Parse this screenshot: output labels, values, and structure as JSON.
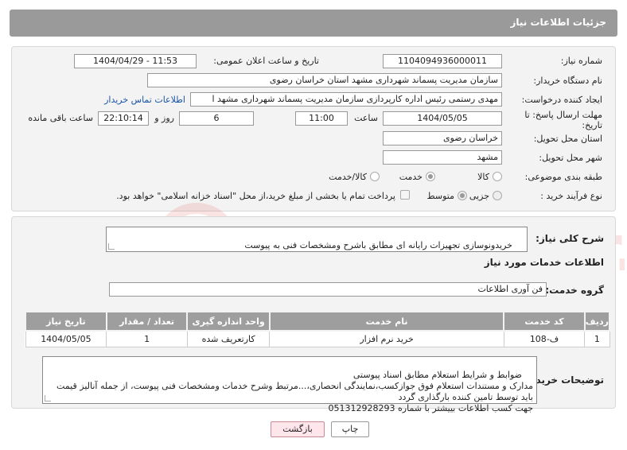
{
  "header": {
    "title": "جزئیات اطلاعات نیاز"
  },
  "info": {
    "need_number_label": "شماره نیاز:",
    "need_number": "1104094936000011",
    "announce_label": "تاریخ و ساعت اعلان عمومی:",
    "announce_value": "1404/04/29 - 11:53",
    "buyer_org_label": "نام دستگاه خریدار:",
    "buyer_org": "سازمان مدیریت پسماند شهرداری مشهد استان خراسان رضوی",
    "requester_label": "ایجاد کننده درخواست:",
    "requester": "مهدی رستمی رئیس اداره کارپردازی سازمان مدیریت پسماند شهرداری مشهد ا",
    "contact_link": "اطلاعات تماس خریدار",
    "deadline_label_1": "مهلت ارسال پاسخ: تا",
    "deadline_label_2": "تاریخ:",
    "deadline_date": "1404/05/05",
    "time_label": "ساعت",
    "deadline_time": "11:00",
    "days_value": "6",
    "days_label": "روز و",
    "remaining_time": "22:10:14",
    "remaining_label": "ساعت باقی مانده",
    "province_label": "استان محل تحویل:",
    "province": "خراسان رضوی",
    "city_label": "شهر محل تحویل:",
    "city": "مشهد",
    "category_label": "طبقه بندی موضوعی:",
    "category_options": [
      "کالا",
      "خدمت",
      "کالا/خدمت"
    ],
    "category_selected": "خدمت",
    "process_label": "نوع فرآیند خرید :",
    "process_options": [
      "جزیی",
      "متوسط"
    ],
    "process_selected": "متوسط",
    "payment_note": "پرداخت تمام یا بخشی از مبلغ خرید،از محل \"اسناد خزانه اسلامی\" خواهد بود."
  },
  "details": {
    "summary_label": "شرح کلی نیاز:",
    "summary": "خریدونوسازی تجهیزات رایانه ای مطابق باشرح ومشخصات فنی به پیوست",
    "services_title": "اطلاعات خدمات مورد نیاز",
    "service_group_label": "گروه خدمت:",
    "service_group": "فن آوری اطلاعات",
    "table": {
      "headers": [
        "ردیف",
        "کد خدمت",
        "نام خدمت",
        "واحد اندازه گیری",
        "تعداد / مقدار",
        "تاریخ نیاز"
      ],
      "rows": [
        [
          "1",
          "ف-108",
          "خرید نرم افزار",
          "کارتعریف شده",
          "1",
          "1404/05/05"
        ]
      ]
    },
    "buyer_notes_label": "توضیحات خریدار:",
    "buyer_notes": "ضوابط و شرایط استعلام مطابق اسناد پیوستی\nمدارک و مستندات استعلام فوق جوازکسب،نمایندگی انحصاری،...مرتبط وشرح خدمات ومشخصات فنی پیوست، از جمله آنالیز قیمت باید توسط تامین کننده بارگذاری گردد\nجهت کسب اطلاعات بییشتر با شماره 051312928293"
  },
  "buttons": {
    "print": "چاپ",
    "back": "بازگشت"
  },
  "watermark": {
    "text": "AriaTender.net"
  },
  "colors": {
    "header": "#9a9a9a",
    "link": "#1a53a8",
    "watermark": "#d33"
  }
}
